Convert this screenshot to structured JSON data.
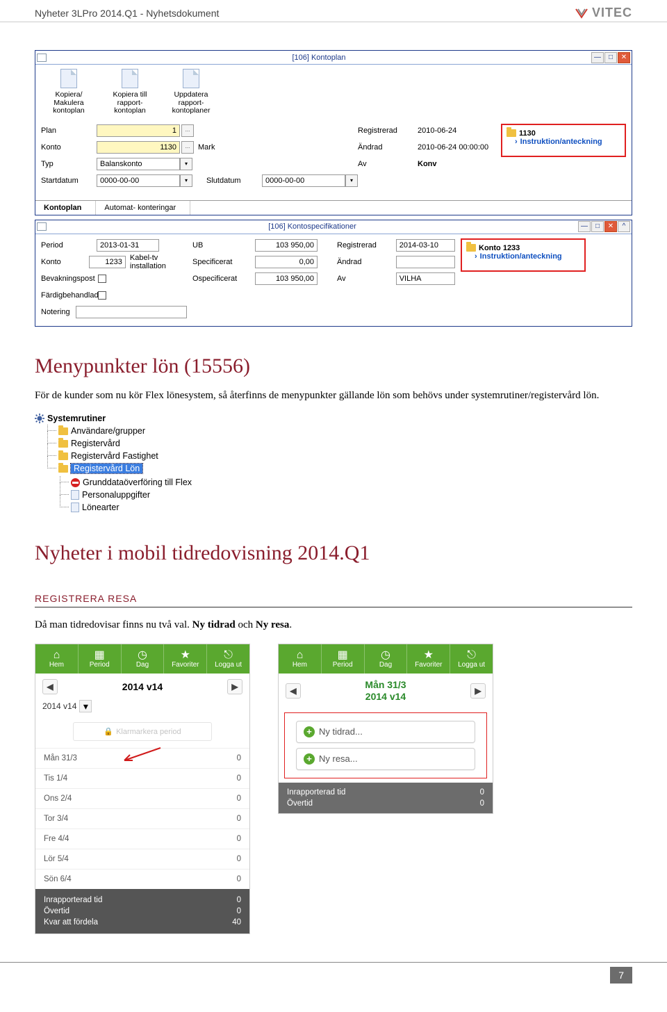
{
  "header": {
    "title": "Nyheter 3LPro 2014.Q1 - Nyhetsdokument",
    "brand": "VITEC"
  },
  "win1": {
    "title": "[106]  Kontoplan",
    "toolbar": {
      "copy": "Kopiera/\nMakulera\nkontoplan",
      "copyto": "Kopiera till\nrapport-\nkontoplan",
      "update": "Uppdatera\nrapport-\nkontoplaner"
    },
    "labels": {
      "plan": "Plan",
      "konto": "Konto",
      "typ": "Typ",
      "startdatum": "Startdatum",
      "slutdatum": "Slutdatum",
      "registrerad": "Registrerad",
      "andrad": "Ändrad",
      "av": "Av"
    },
    "values": {
      "plan": "1",
      "konto": "1130",
      "konto_text": "Mark",
      "typ": "Balanskonto",
      "startdatum": "0000-00-00",
      "slutdatum": "0000-00-00",
      "registrerad": "2010-06-24",
      "andrad": "2010-06-24 00:00:00",
      "av": "Konv"
    },
    "side": {
      "folder": "1130",
      "link": "Instruktion/anteckning"
    },
    "tabs": {
      "kontoplan": "Kontoplan",
      "automat": "Automat- konteringar"
    }
  },
  "win2": {
    "title": "[106]  Kontospecifikationer",
    "labels": {
      "period": "Period",
      "konto": "Konto",
      "bevak": "Bevakningspost",
      "fardig": "Färdigbehandlad",
      "notering": "Notering",
      "ub": "UB",
      "spec": "Specificerat",
      "ospec": "Ospecificerat",
      "registrerad": "Registrerad",
      "andrad": "Ändrad",
      "av": "Av"
    },
    "values": {
      "period": "2013-01-31",
      "konto": "1233",
      "konto_text": "Kabel-tv installation",
      "ub": "103 950,00",
      "spec": "0,00",
      "ospec": "103 950,00",
      "registrerad": "2014-03-10",
      "andrad": "",
      "av": "VILHA"
    },
    "side": {
      "folder": "Konto 1233",
      "link": "Instruktion/anteckning"
    }
  },
  "article1": {
    "heading": "Menypunkter lön (15556)",
    "text": "För de kunder som nu kör Flex lönesystem, så återfinns de menypunkter gällande lön som behövs under systemrutiner/registervård lön."
  },
  "tree": {
    "root": "Systemrutiner",
    "items": [
      "Användare/grupper",
      "Registervård",
      "Registervård Fastighet",
      "Registervård Lön"
    ],
    "children": [
      "Grunddataöverföring till Flex",
      "Personaluppgifter",
      "Lönearter"
    ]
  },
  "article2": {
    "heading": "Nyheter i mobil tidredovisning 2014.Q1",
    "sub": "REGISTRERA RESA",
    "text": "Då man tidredovisar finns nu två val. Ny tidrad och Ny resa."
  },
  "mobile1": {
    "toolbar": {
      "hem": "Hem",
      "period": "Period",
      "dag": "Dag",
      "fav": "Favoriter",
      "logga": "Logga ut"
    },
    "title": "2014 v14",
    "klar_text": "Klarmarkera period",
    "rows": [
      {
        "day": "Mån 31/3",
        "val": "0"
      },
      {
        "day": "Tis 1/4",
        "val": "0"
      },
      {
        "day": "Ons 2/4",
        "val": "0"
      },
      {
        "day": "Tor 3/4",
        "val": "0"
      },
      {
        "day": "Fre 4/4",
        "val": "0"
      },
      {
        "day": "Lör 5/4",
        "val": "0"
      },
      {
        "day": "Sön 6/4",
        "val": "0"
      }
    ],
    "footer": {
      "inrapp": "Inrapporterad tid",
      "inrapp_v": "0",
      "overtid": "Övertid",
      "overtid_v": "0",
      "kvar": "Kvar att fördela",
      "kvar_v": "40"
    }
  },
  "mobile2": {
    "toolbar": {
      "hem": "Hem",
      "period": "Period",
      "dag": "Dag",
      "fav": "Favoriter",
      "logga": "Logga ut"
    },
    "title_line1": "Mån 31/3",
    "title_line2": "2014 v14",
    "ny_tidrad": "Ny tidrad...",
    "ny_resa": "Ny resa...",
    "summary": {
      "inrapp": "Inrapporterad tid",
      "inrapp_v": "0",
      "overtid": "Övertid",
      "overtid_v": "0"
    }
  },
  "page_number": "7"
}
